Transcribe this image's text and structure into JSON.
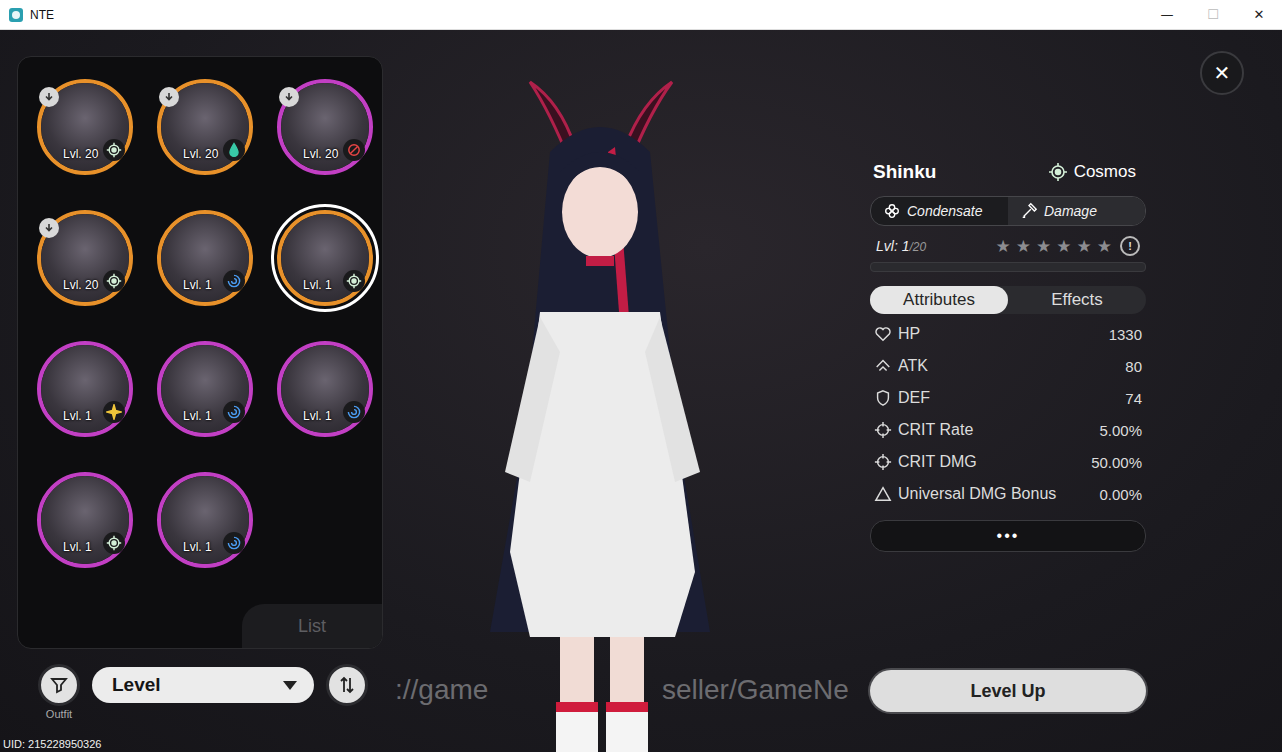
{
  "window": {
    "title": "NTE",
    "controls": [
      {
        "label": "—",
        "disabled": false
      },
      {
        "label": "☐",
        "disabled": true
      },
      {
        "label": "✕",
        "disabled": false
      }
    ]
  },
  "roster": {
    "characters": [
      {
        "level": "Lvl. 20",
        "color": "#e8912a",
        "element": "cosmos",
        "download_badge": true,
        "selected": false
      },
      {
        "level": "Lvl. 20",
        "color": "#e8912a",
        "element": "water",
        "download_badge": true,
        "selected": false
      },
      {
        "level": "Lvl. 20",
        "color": "#c23fc4",
        "element": "anomaly",
        "download_badge": true,
        "selected": false
      },
      {
        "level": "Lvl. 20",
        "color": "#e8912a",
        "element": "cosmos",
        "download_badge": true,
        "selected": false
      },
      {
        "level": "Lvl. 1",
        "color": "#e8912a",
        "element": "psi",
        "download_badge": false,
        "selected": false
      },
      {
        "level": "Lvl. 1",
        "color": "#e8912a",
        "element": "cosmos",
        "download_badge": false,
        "selected": true
      },
      {
        "level": "Lvl. 1",
        "color": "#c23fc4",
        "element": "lux",
        "download_badge": false,
        "selected": false
      },
      {
        "level": "Lvl. 1",
        "color": "#c23fc4",
        "element": "psi",
        "download_badge": false,
        "selected": false
      },
      {
        "level": "Lvl. 1",
        "color": "#c23fc4",
        "element": "psi",
        "download_badge": false,
        "selected": false
      },
      {
        "level": "Lvl. 1",
        "color": "#c23fc4",
        "element": "cosmos",
        "download_badge": false,
        "selected": false
      },
      {
        "level": "Lvl. 1",
        "color": "#c23fc4",
        "element": "psi",
        "download_badge": false,
        "selected": false
      }
    ],
    "tab_label": "List"
  },
  "sort": {
    "label": "Level"
  },
  "outfit_label": "Outfit",
  "uid": "UID: 215228950326",
  "watermark": [
    "://game",
    "seller/GameNe"
  ],
  "character": {
    "name": "Shinku",
    "element": {
      "label": "Cosmos",
      "kind": "cosmos"
    },
    "tags": [
      {
        "label": "Condensate",
        "kind": "condensate"
      },
      {
        "label": "Damage",
        "kind": "damage"
      }
    ],
    "level": "Lvl: 1",
    "level_cap": "/20",
    "stars": 0,
    "max_stars": 6,
    "exp_level": 0,
    "info_icon": "!"
  },
  "tabs": [
    {
      "label": "Attributes",
      "selected": true
    },
    {
      "label": "Effects",
      "selected": false
    }
  ],
  "stats": [
    {
      "kind": "hp",
      "label": "HP",
      "value": "1330"
    },
    {
      "kind": "atk",
      "label": "ATK",
      "value": "80"
    },
    {
      "kind": "def",
      "label": "DEF",
      "value": "74"
    },
    {
      "kind": "crit",
      "label": "CRIT Rate",
      "value": "5.00%"
    },
    {
      "kind": "crit",
      "label": "CRIT DMG",
      "value": "50.00%"
    },
    {
      "kind": "bonus",
      "label": "Universal DMG Bonus",
      "value": "0.00%"
    }
  ],
  "more_button": "•••",
  "level_up_button": "Level Up",
  "close_button": "✕"
}
